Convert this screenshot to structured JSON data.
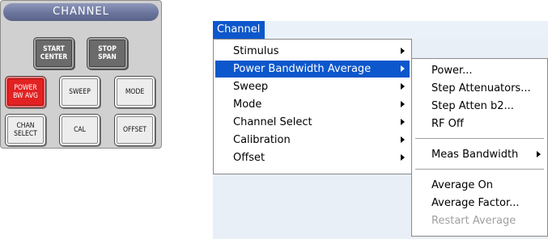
{
  "panel": {
    "title": "CHANNEL",
    "keys": {
      "start_center": "START\nCENTER",
      "stop_span": "STOP\nSPAN",
      "power_bw_avg": "POWER\nBW AVG",
      "sweep": "SWEEP",
      "mode": "MODE",
      "chan_select": "CHAN\nSELECT",
      "cal": "CAL",
      "offset": "OFFSET"
    }
  },
  "menubar": {
    "title": "Channel"
  },
  "channel_menu": {
    "items": [
      {
        "label": "Stimulus",
        "submenu": true
      },
      {
        "label": "Power Bandwidth Average",
        "submenu": true,
        "selected": true
      },
      {
        "label": "Sweep",
        "submenu": true
      },
      {
        "label": "Mode",
        "submenu": true
      },
      {
        "label": "Channel Select",
        "submenu": true
      },
      {
        "label": "Calibration",
        "submenu": true
      },
      {
        "label": "Offset",
        "submenu": true
      }
    ]
  },
  "submenu": {
    "items": [
      {
        "label": "Power..."
      },
      {
        "label": "Step Attenuators..."
      },
      {
        "label": "Step Atten b2..."
      },
      {
        "label": "RF Off"
      },
      {
        "label": "Meas Bandwidth",
        "submenu": true
      },
      {
        "label": "Average On"
      },
      {
        "label": "Average Factor..."
      },
      {
        "label": "Restart Average",
        "disabled": true
      }
    ]
  },
  "colors": {
    "highlight": "#0d57cc",
    "panel_bg": "#d0d0d0",
    "power_key": "#e22222",
    "dark_key": "#6b6b6b",
    "disabled_text": "#a0a0a0"
  }
}
